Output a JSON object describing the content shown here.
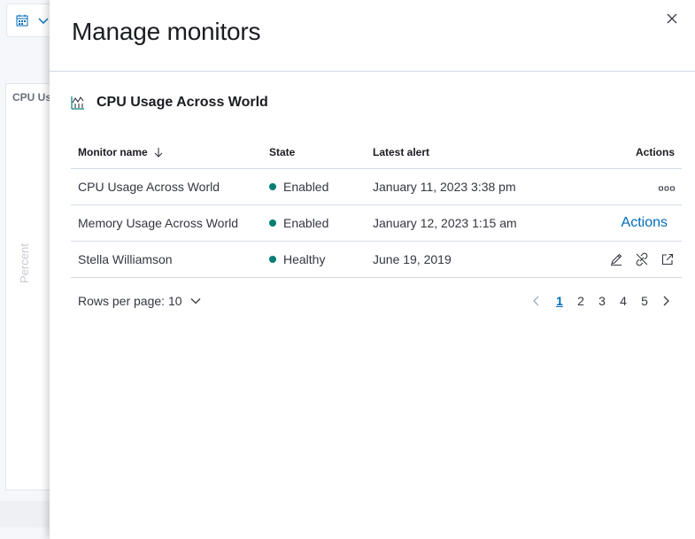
{
  "background": {
    "panel_title": "CPU Us",
    "y_axis_label": "Percent"
  },
  "flyout": {
    "title": "Manage monitors",
    "section_title": "CPU Usage Across World"
  },
  "table": {
    "columns": {
      "name": "Monitor name",
      "state": "State",
      "latest_alert": "Latest alert",
      "actions": "Actions"
    },
    "rows": [
      {
        "name": "CPU Usage Across World",
        "state": "Enabled",
        "latest_alert": "January 11, 2023 3:38 pm"
      },
      {
        "name": "Memory Usage Across World",
        "state": "Enabled",
        "latest_alert": "January 12, 2023 1:15 am",
        "action_label": "Actions"
      },
      {
        "name": "Stella Williamson",
        "state": "Healthy",
        "latest_alert": "June 19, 2019"
      }
    ]
  },
  "pagination": {
    "rows_per_page_label": "Rows per page: 10",
    "pages": [
      "1",
      "2",
      "3",
      "4",
      "5"
    ],
    "current_page": "1"
  },
  "colors": {
    "accent": "#006bb8",
    "status_dot": "#017d73"
  }
}
